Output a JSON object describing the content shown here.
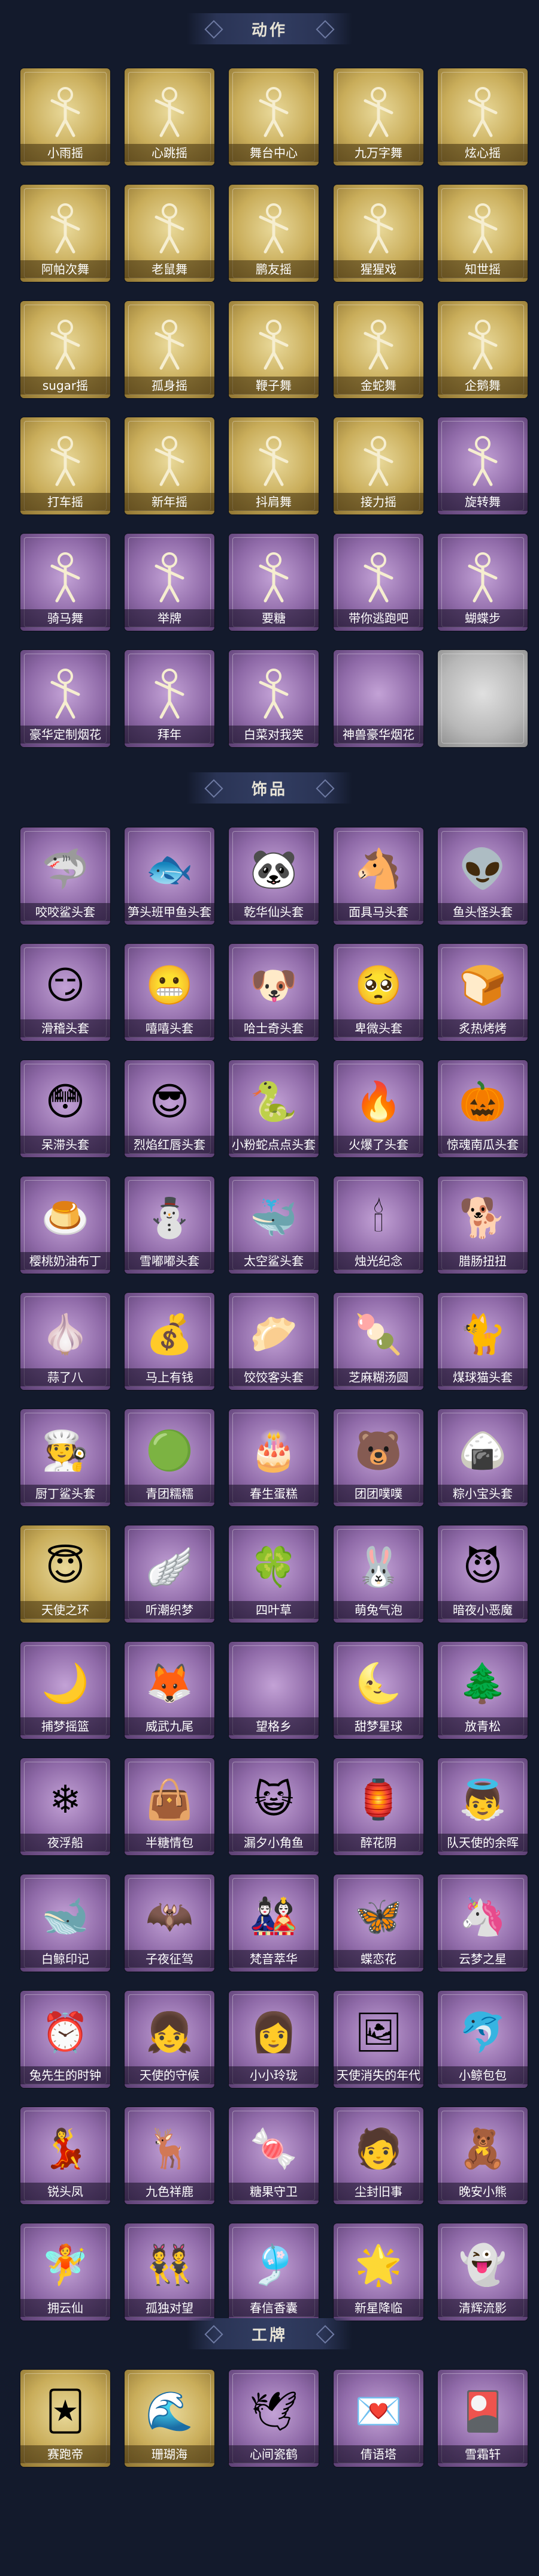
{
  "sections": [
    {
      "title": "动作",
      "items": [
        {
          "label": "小雨摇",
          "theme": "gold",
          "icon": "pose-icon"
        },
        {
          "label": "心跳摇",
          "theme": "gold",
          "icon": "pose-icon"
        },
        {
          "label": "舞台中心",
          "theme": "gold",
          "icon": "pose-icon"
        },
        {
          "label": "九万字舞",
          "theme": "gold",
          "icon": "pose-icon"
        },
        {
          "label": "炫心摇",
          "theme": "gold",
          "icon": "pose-icon"
        },
        {
          "label": "阿帕次舞",
          "theme": "gold",
          "icon": "pose-icon"
        },
        {
          "label": "老鼠舞",
          "theme": "gold",
          "icon": "pose-icon"
        },
        {
          "label": "鹏友摇",
          "theme": "gold",
          "icon": "pose-icon"
        },
        {
          "label": "猩猩戏",
          "theme": "gold",
          "icon": "pose-icon"
        },
        {
          "label": "知世摇",
          "theme": "gold",
          "icon": "pose-icon"
        },
        {
          "label": "sugar摇",
          "theme": "gold",
          "icon": "pose-icon"
        },
        {
          "label": "孤身摇",
          "theme": "gold",
          "icon": "pose-icon"
        },
        {
          "label": "鞭子舞",
          "theme": "gold",
          "icon": "pose-icon"
        },
        {
          "label": "金蛇舞",
          "theme": "gold",
          "icon": "pose-icon"
        },
        {
          "label": "企鹅舞",
          "theme": "gold",
          "icon": "pose-icon"
        },
        {
          "label": "打车摇",
          "theme": "gold",
          "icon": "pose-icon"
        },
        {
          "label": "新年摇",
          "theme": "gold",
          "icon": "pose-icon"
        },
        {
          "label": "抖肩舞",
          "theme": "gold",
          "icon": "pose-icon"
        },
        {
          "label": "接力摇",
          "theme": "gold",
          "icon": "pose-icon"
        },
        {
          "label": "旋转舞",
          "theme": "purple",
          "icon": "pose-icon"
        },
        {
          "label": "骑马舞",
          "theme": "purple",
          "icon": "pose-icon"
        },
        {
          "label": "举牌",
          "theme": "purple",
          "icon": "sign-icon"
        },
        {
          "label": "要糖",
          "theme": "purple",
          "icon": "pose-icon"
        },
        {
          "label": "带你逃跑吧",
          "theme": "purple",
          "icon": "pose-icon"
        },
        {
          "label": "蝴蝶步",
          "theme": "purple",
          "icon": "pose-icon"
        },
        {
          "label": "豪华定制烟花",
          "theme": "purple",
          "icon": "firework-icon"
        },
        {
          "label": "拜年",
          "theme": "purple",
          "icon": "pose-icon"
        },
        {
          "label": "白菜对我笑",
          "theme": "purple",
          "icon": "pose-icon"
        },
        {
          "label": "神兽豪华烟花",
          "theme": "purple",
          "icon": "blank-icon"
        },
        {
          "label": "",
          "theme": "gray",
          "icon": "blank-icon"
        }
      ]
    },
    {
      "title": "饰品",
      "items": [
        {
          "label": "咬咬鲨头套",
          "theme": "purple",
          "icon": "shark-icon",
          "glyph": "🦈"
        },
        {
          "label": "笋头班甲鱼头套",
          "theme": "purple",
          "icon": "fish-icon",
          "glyph": "🐟"
        },
        {
          "label": "乾华仙头套",
          "theme": "purple",
          "icon": "panda-icon",
          "glyph": "🐼"
        },
        {
          "label": "面具马头套",
          "theme": "purple",
          "icon": "horse-icon",
          "glyph": "🐴"
        },
        {
          "label": "鱼头怪头套",
          "theme": "purple",
          "icon": "monster-icon",
          "glyph": "👽"
        },
        {
          "label": "滑稽头套",
          "theme": "purple",
          "icon": "smirk-icon",
          "glyph": "😏"
        },
        {
          "label": "嘻嘻头套",
          "theme": "purple",
          "icon": "grin-icon",
          "glyph": "😬"
        },
        {
          "label": "哈士奇头套",
          "theme": "purple",
          "icon": "dog-icon",
          "glyph": "🐶"
        },
        {
          "label": "卑微头套",
          "theme": "purple",
          "icon": "sad-icon",
          "glyph": "🥺"
        },
        {
          "label": "炙热烤烤",
          "theme": "purple",
          "icon": "toast-icon",
          "glyph": "🍞"
        },
        {
          "label": "呆滞头套",
          "theme": "purple",
          "icon": "dazed-icon",
          "glyph": "😳"
        },
        {
          "label": "烈焰红唇头套",
          "theme": "purple",
          "icon": "pikachu-icon",
          "glyph": "😎"
        },
        {
          "label": "小粉蛇点点头套",
          "theme": "purple",
          "icon": "snake-icon",
          "glyph": "🐍"
        },
        {
          "label": "火爆了头套",
          "theme": "purple",
          "icon": "fire-icon",
          "glyph": "🔥"
        },
        {
          "label": "惊魂南瓜头套",
          "theme": "purple",
          "icon": "pumpkin-icon",
          "glyph": "🎃"
        },
        {
          "label": "樱桃奶油布丁",
          "theme": "purple",
          "icon": "pudding-icon",
          "glyph": "🍮"
        },
        {
          "label": "雪嘟嘟头套",
          "theme": "purple",
          "icon": "snowman-icon",
          "glyph": "⛄"
        },
        {
          "label": "太空鲨头套",
          "theme": "purple",
          "icon": "space-shark-icon",
          "glyph": "🐳"
        },
        {
          "label": "烛光纪念",
          "theme": "purple",
          "icon": "candle-icon",
          "glyph": "🕯"
        },
        {
          "label": "腊肠扭扭",
          "theme": "purple",
          "icon": "sausage-dog-icon",
          "glyph": "🐕"
        },
        {
          "label": "蒜了八",
          "theme": "purple",
          "icon": "garlic-icon",
          "glyph": "🧄"
        },
        {
          "label": "马上有钱",
          "theme": "purple",
          "icon": "money-icon",
          "glyph": "💰"
        },
        {
          "label": "饺饺客头套",
          "theme": "purple",
          "icon": "dumpling-icon",
          "glyph": "🥟"
        },
        {
          "label": "芝麻糊汤圆",
          "theme": "purple",
          "icon": "tangyuan-icon",
          "glyph": "🍡"
        },
        {
          "label": "煤球猫头套",
          "theme": "purple",
          "icon": "cat-icon",
          "glyph": "🐈"
        },
        {
          "label": "厨丁鲨头套",
          "theme": "purple",
          "icon": "chef-icon",
          "glyph": "🧑‍🍳"
        },
        {
          "label": "青团糯糯",
          "theme": "purple",
          "icon": "qingtuan-icon",
          "glyph": "🟢"
        },
        {
          "label": "春生蛋糕",
          "theme": "purple",
          "icon": "cake-icon",
          "glyph": "🎂"
        },
        {
          "label": "团团噗噗",
          "theme": "purple",
          "icon": "bear-icon",
          "glyph": "🐻"
        },
        {
          "label": "粽小宝头套",
          "theme": "purple",
          "icon": "zongzi-icon",
          "glyph": "🍙"
        },
        {
          "label": "天使之环",
          "theme": "gold",
          "icon": "halo-icon",
          "glyph": "😇"
        },
        {
          "label": "听潮织梦",
          "theme": "purple",
          "icon": "wings-icon",
          "glyph": "🪽"
        },
        {
          "label": "四叶草",
          "theme": "purple",
          "icon": "clover-icon",
          "glyph": "🍀"
        },
        {
          "label": "萌兔气泡",
          "theme": "purple",
          "icon": "bunny-icon",
          "glyph": "🐰"
        },
        {
          "label": "暗夜小恶魔",
          "theme": "purple",
          "icon": "devil-icon",
          "glyph": "😈"
        },
        {
          "label": "捕梦摇篮",
          "theme": "purple",
          "icon": "dreamcatcher-icon",
          "glyph": "🌙"
        },
        {
          "label": "威武九尾",
          "theme": "purple",
          "icon": "fox-icon",
          "glyph": "🦊"
        },
        {
          "label": "望格乡",
          "theme": "purple",
          "icon": "blank-icon",
          "glyph": "✦"
        },
        {
          "label": "甜梦星球",
          "theme": "purple",
          "icon": "moon-icon",
          "glyph": "🌜"
        },
        {
          "label": "放青松",
          "theme": "purple",
          "icon": "pine-icon",
          "glyph": "🌲"
        },
        {
          "label": "夜浮船",
          "theme": "purple",
          "icon": "snowflake-icon",
          "glyph": "❄"
        },
        {
          "label": "半糖情包",
          "theme": "purple",
          "icon": "bag-icon",
          "glyph": "👜"
        },
        {
          "label": "漏夕小角鱼",
          "theme": "purple",
          "icon": "blue-cat-icon",
          "glyph": "😺"
        },
        {
          "label": "醉花阴",
          "theme": "purple",
          "icon": "lantern-icon",
          "glyph": "🏮"
        },
        {
          "label": "队天使的余晖",
          "theme": "purple",
          "icon": "angel-icon",
          "glyph": "👼"
        },
        {
          "label": "白鲸印记",
          "theme": "purple",
          "icon": "whale-icon",
          "glyph": "🐋"
        },
        {
          "label": "子夜征驾",
          "theme": "purple",
          "icon": "dark-angel-icon",
          "glyph": "🦇"
        },
        {
          "label": "梵音萃华",
          "theme": "purple",
          "icon": "doll-icon",
          "glyph": "🎎"
        },
        {
          "label": "蝶恋花",
          "theme": "purple",
          "icon": "butterfly-icon",
          "glyph": "🦋"
        },
        {
          "label": "云梦之星",
          "theme": "purple",
          "icon": "unicorn-icon",
          "glyph": "🦄"
        },
        {
          "label": "兔先生的时钟",
          "theme": "purple",
          "icon": "clock-icon",
          "glyph": "⏰"
        },
        {
          "label": "天使的守候",
          "theme": "purple",
          "icon": "guardian-icon",
          "glyph": "👧"
        },
        {
          "label": "小小玲珑",
          "theme": "purple",
          "icon": "girl-icon",
          "glyph": "👩"
        },
        {
          "label": "天使消失的年代",
          "theme": "purple",
          "icon": "portrait-icon",
          "glyph": "🖼"
        },
        {
          "label": "小鲸包包",
          "theme": "purple",
          "icon": "whale-bag-icon",
          "glyph": "🐬"
        },
        {
          "label": "锐头凤",
          "theme": "purple",
          "icon": "phoenix-icon",
          "glyph": "💃"
        },
        {
          "label": "九色祥鹿",
          "theme": "purple",
          "icon": "deer-icon",
          "glyph": "🦌"
        },
        {
          "label": "糖果守卫",
          "theme": "purple",
          "icon": "candy-icon",
          "glyph": "🍬"
        },
        {
          "label": "尘封旧事",
          "theme": "purple",
          "icon": "boy-icon",
          "glyph": "🧑"
        },
        {
          "label": "晚安小熊",
          "theme": "purple",
          "icon": "teddy-icon",
          "glyph": "🧸"
        },
        {
          "label": "拥云仙",
          "theme": "purple",
          "icon": "fairy-icon",
          "glyph": "🧚"
        },
        {
          "label": "孤独对望",
          "theme": "purple",
          "icon": "twins-icon",
          "glyph": "👯"
        },
        {
          "label": "春信香囊",
          "theme": "purple",
          "icon": "sachet-icon",
          "glyph": "🎐"
        },
        {
          "label": "新星降临",
          "theme": "purple",
          "icon": "star-doll-icon",
          "glyph": "🌟"
        },
        {
          "label": "清辉流影",
          "theme": "purple",
          "icon": "ghost-icon",
          "glyph": "👻"
        }
      ]
    },
    {
      "title": "工牌",
      "items": [
        {
          "label": "赛跑帝",
          "theme": "gold",
          "icon": "card-icon",
          "glyph": "🃏"
        },
        {
          "label": "珊瑚海",
          "theme": "gold",
          "icon": "card-icon",
          "glyph": "🌊"
        },
        {
          "label": "心间瓷鹤",
          "theme": "purple",
          "icon": "card-icon",
          "glyph": "🕊"
        },
        {
          "label": "倩语塔",
          "theme": "purple",
          "icon": "card-icon",
          "glyph": "💌"
        },
        {
          "label": "雪霜轩",
          "theme": "purple",
          "icon": "card-icon",
          "glyph": "🎴"
        }
      ]
    }
  ]
}
